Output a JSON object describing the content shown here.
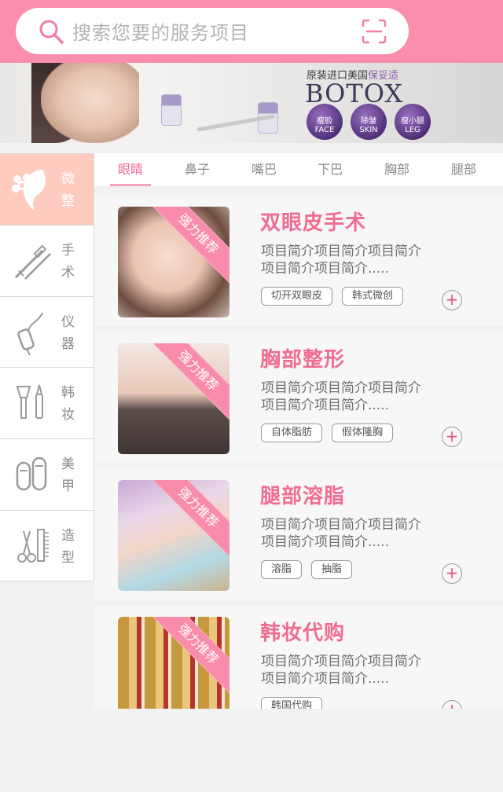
{
  "search": {
    "placeholder": "搜索您要的服务项目",
    "icon": "search-icon",
    "scan_icon": "scan-icon"
  },
  "banner": {
    "subtitle_prefix": "原装进口美国",
    "subtitle_highlight": "保妥适",
    "brand": "BOTOX",
    "badges": [
      {
        "cn": "瘦脸",
        "en": "FACE"
      },
      {
        "cn": "除皱",
        "en": "SKIN"
      },
      {
        "cn": "瘦小腿",
        "en": "LEG"
      }
    ]
  },
  "sidebar": {
    "items": [
      {
        "label": "微整",
        "icon": "flower-face-icon",
        "active": true
      },
      {
        "label": "手术",
        "icon": "scalpel-syringe-icon",
        "active": false
      },
      {
        "label": "仪器",
        "icon": "device-icon",
        "active": false
      },
      {
        "label": "韩妆",
        "icon": "makeup-brush-icon",
        "active": false
      },
      {
        "label": "美甲",
        "icon": "nail-icon",
        "active": false
      },
      {
        "label": "造型",
        "icon": "comb-scissors-icon",
        "active": false
      }
    ]
  },
  "tabs": [
    {
      "label": "眼睛",
      "active": true
    },
    {
      "label": "鼻子",
      "active": false
    },
    {
      "label": "嘴巴",
      "active": false
    },
    {
      "label": "下巴",
      "active": false
    },
    {
      "label": "胸部",
      "active": false
    },
    {
      "label": "腿部",
      "active": false
    }
  ],
  "cards": [
    {
      "title": "双眼皮手术",
      "ribbon": "强力推荐",
      "desc_line1": "项目简介项目简介项目简介",
      "desc_line2": "项目简介项目简介.....",
      "tags": [
        "切开双眼皮",
        "韩式微创"
      ]
    },
    {
      "title": "胸部整形",
      "ribbon": "强力推荐",
      "desc_line1": "项目简介项目简介项目简介",
      "desc_line2": "项目简介项目简介.....",
      "tags": [
        "自体脂肪",
        "假体隆胸"
      ]
    },
    {
      "title": "腿部溶脂",
      "ribbon": "强力推荐",
      "desc_line1": "项目简介项目简介项目简介",
      "desc_line2": "项目简介项目简介.....",
      "tags": [
        "溶脂",
        "抽脂"
      ]
    },
    {
      "title": "韩妆代购",
      "ribbon": "强力推荐",
      "desc_line1": "项目简介项目简介项目简介",
      "desc_line2": "项目简介项目简介.....",
      "tags": [
        "韩国代购"
      ]
    }
  ],
  "plus_label": "+",
  "colors": {
    "header": "#f98fad",
    "accent": "#f06c93",
    "sidebar_active": "#ffcbbf"
  }
}
